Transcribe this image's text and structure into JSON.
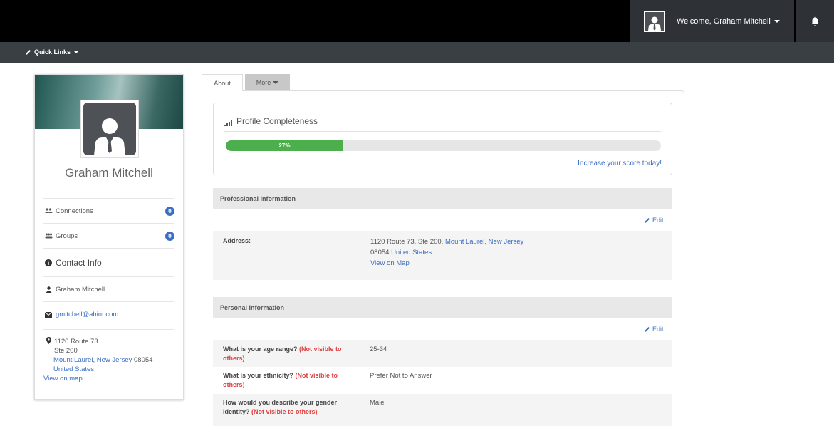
{
  "header": {
    "welcome": "Welcome, Graham Mitchell"
  },
  "quickbar": {
    "quick_links": "Quick Links"
  },
  "profile": {
    "name": "Graham Mitchell",
    "connections_label": "Connections",
    "connections_count": "0",
    "groups_label": "Groups",
    "groups_count": "0",
    "contact_title": "Contact Info",
    "contact_name": "Graham Mitchell",
    "email": "gmitchell@ahint.com",
    "address_line1": "1120 Route 73",
    "address_line2": "Ste 200",
    "city": "Mount Laurel,",
    "state": "New Jersey",
    "zip": "08054",
    "country": "United States",
    "map_link": "View on map"
  },
  "tabs": {
    "about": "About",
    "more": "More"
  },
  "completeness": {
    "title": "Profile Completeness",
    "percent_label": "27%",
    "percent": 27,
    "increase_link": "Increase your score today!"
  },
  "professional": {
    "header": "Professional Information",
    "edit": "Edit",
    "address_label": "Address:",
    "street": "1120 Route 73,  Ste 200,",
    "city": "Mount Laurel,",
    "state": "New Jersey",
    "zip": "08054",
    "country": "United States",
    "map_link": "View on Map"
  },
  "personal": {
    "header": "Personal Information",
    "edit": "Edit",
    "not_visible": "(Not visible to others)",
    "age_question": "What is your age range?",
    "age_value": "25-34",
    "ethnicity_question": "What is your ethnicity?",
    "ethnicity_value": "Prefer Not to Answer",
    "gender_question": "How would you describe your gender identity?",
    "gender_value": "Male"
  },
  "colors": {
    "accent": "#3b6fc4",
    "progress": "#4cae4c",
    "warning": "#e04040",
    "topbar": "#000000"
  }
}
